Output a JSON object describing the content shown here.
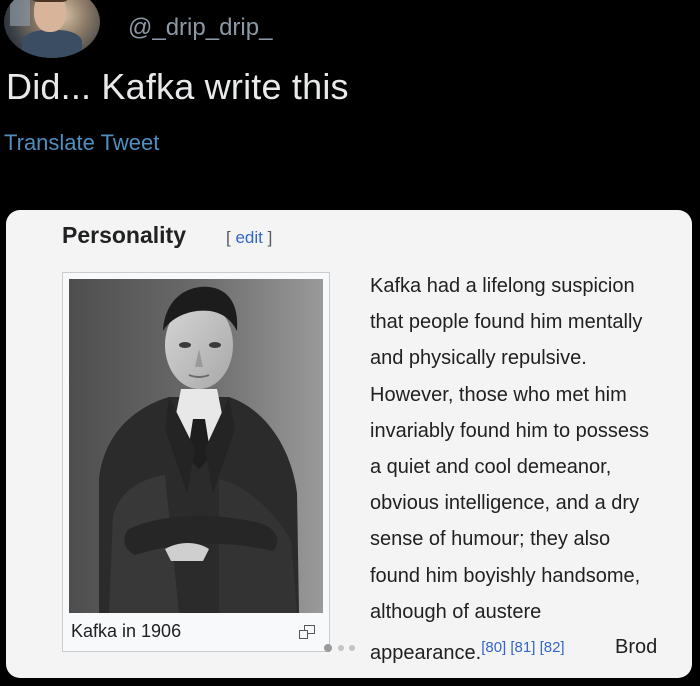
{
  "tweet": {
    "handle": "@_drip_drip_",
    "text": "Did... Kafka write this",
    "translate_label": "Translate Tweet"
  },
  "wiki_card": {
    "section_title": "Personality",
    "edit_open": "[",
    "edit_label": "edit",
    "edit_close": "]",
    "image_caption": "Kafka in 1906",
    "body_lines": [
      "Kafka had a lifelong suspicion",
      "that people found him mentally",
      "and physically repulsive.",
      "However, those who met him",
      "invariably found him to possess",
      "a quiet and cool demeanor,",
      "obvious intelligence, and a dry",
      "sense of humour; they also",
      "found him boyishly handsome,",
      "although of austere",
      "appearance."
    ],
    "references": "[80] [81] [82]",
    "trailing_word": "Brod"
  },
  "icons": {
    "avatar": "avatar",
    "magnify": "magnify-clip-icon",
    "carousel": "carousel-dots-icon"
  },
  "colors": {
    "background": "#000000",
    "handle": "#8b98a5",
    "tweet_text": "#e7e9ea",
    "translate": "#4f8fc0",
    "card_bg": "#f4f4f4",
    "wiki_link": "#3366cc"
  }
}
